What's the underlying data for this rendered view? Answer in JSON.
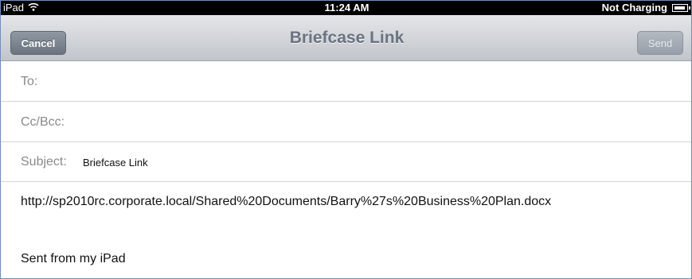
{
  "status_bar": {
    "carrier": "iPad",
    "wifi_icon": "wifi-icon",
    "time": "11:24 AM",
    "battery_text": "Not Charging",
    "battery_icon": "battery-icon"
  },
  "nav": {
    "cancel_label": "Cancel",
    "title": "Briefcase Link",
    "send_label": "Send"
  },
  "fields": {
    "to_label": "To:",
    "to_value": "",
    "cc_label": "Cc/Bcc:",
    "cc_value": "",
    "subject_label": "Subject:",
    "subject_value": "Briefcase Link"
  },
  "body": {
    "link": "http://sp2010rc.corporate.local/Shared%20Documents/Barry%27s%20Business%20Plan.docx",
    "signature": "Sent from my iPad"
  }
}
